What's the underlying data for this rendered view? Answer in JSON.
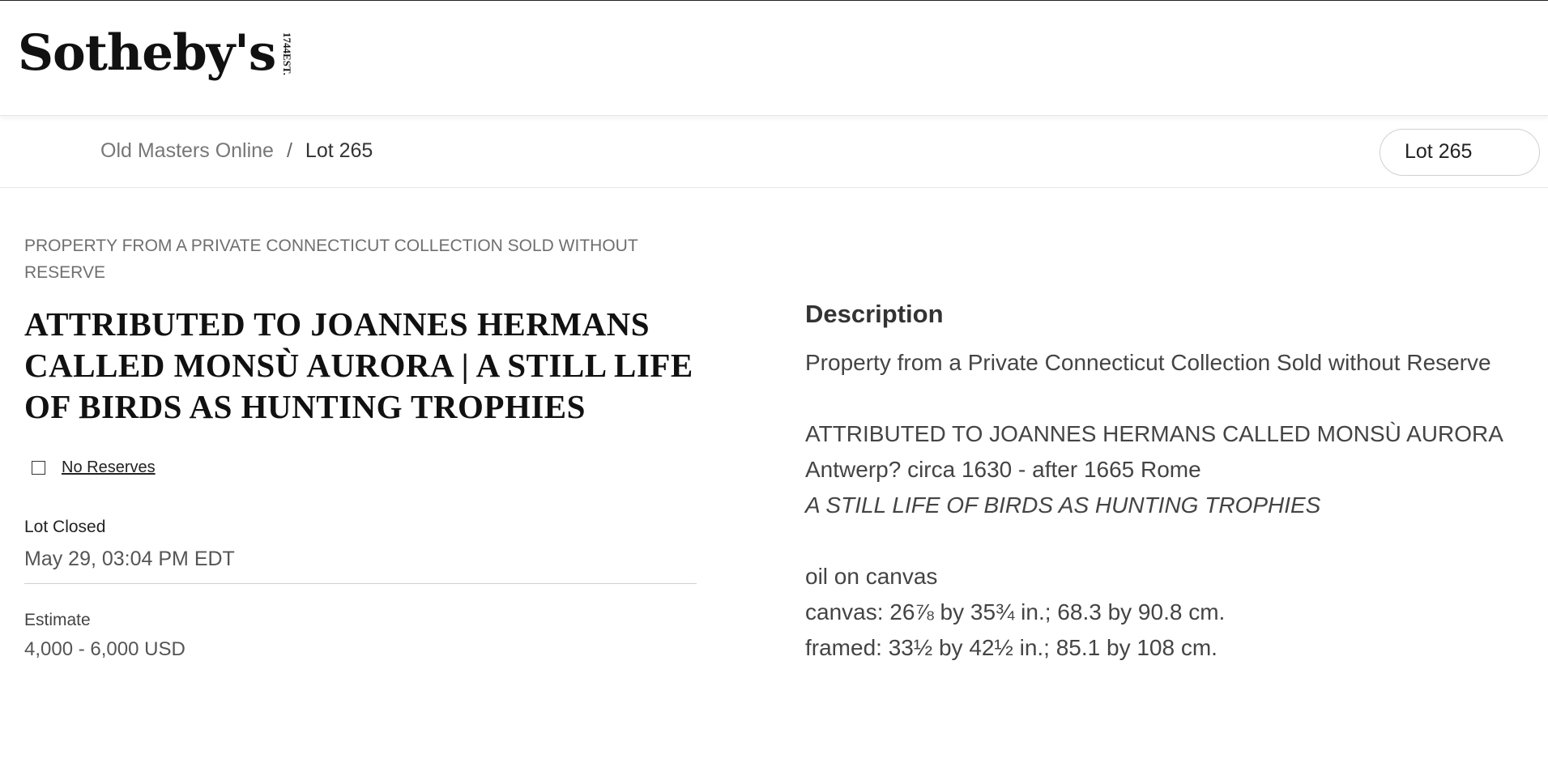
{
  "header": {
    "logo_text": "Sotheby's",
    "logo_est_line1": "EST.",
    "logo_est_line2": "1744"
  },
  "breadcrumb": {
    "parent": "Old Masters Online",
    "separator": "/",
    "current": "Lot 265"
  },
  "lot_selector": {
    "label": "Lot 265"
  },
  "lot": {
    "provenance": "PROPERTY FROM A PRIVATE CONNECTICUT COLLECTION SOLD WITHOUT RESERVE",
    "title": "ATTRIBUTED TO JOANNES HERMANS CALLED MONSÙ AURORA | A STILL LIFE OF BIRDS AS HUNTING TROPHIES",
    "no_reserves_label": "No Reserves",
    "lot_closed_label": "Lot Closed",
    "lot_closed_value": "May 29, 03:04 PM EDT",
    "estimate_label": "Estimate",
    "estimate_value": "4,000 - 6,000 USD"
  },
  "description": {
    "heading": "Description",
    "line1": "Property from a Private Connecticut Collection Sold without Reserve",
    "line2": "ATTRIBUTED TO JOANNES HERMANS CALLED MONSÙ AURORA",
    "line3": "Antwerp? circa 1630 - after 1665 Rome",
    "line4": "A STILL LIFE OF BIRDS AS HUNTING TROPHIES",
    "line5": "oil on canvas",
    "line6": "canvas: 26⅞ by 35¾ in.; 68.3 by 90.8 cm.",
    "line7": "framed: 33½ by 42½ in.; 85.1 by 108 cm."
  }
}
